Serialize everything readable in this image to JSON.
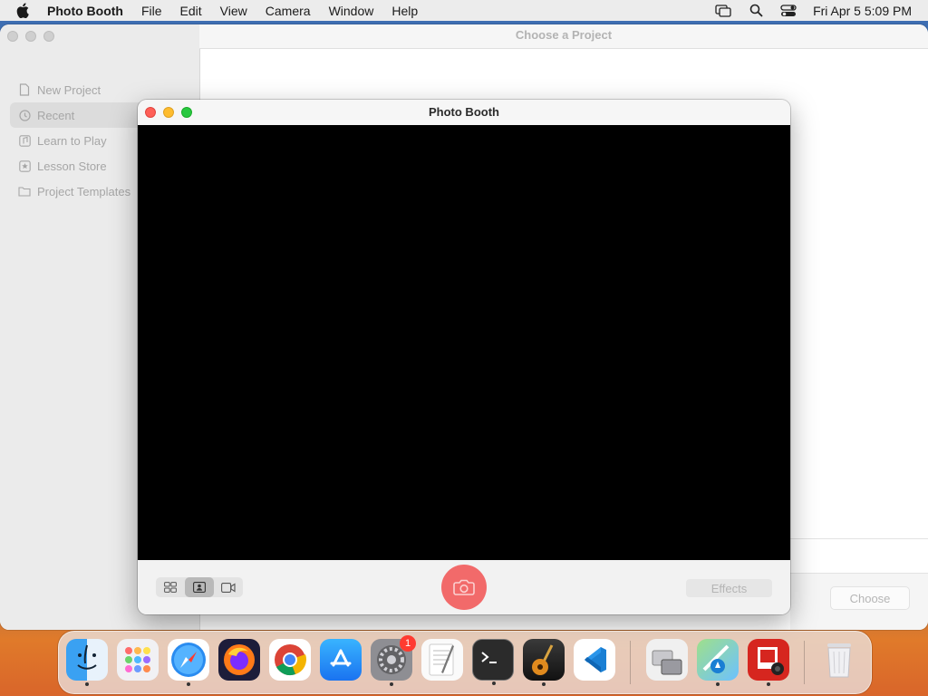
{
  "menubar": {
    "app_name": "Photo Booth",
    "menus": [
      "File",
      "Edit",
      "View",
      "Camera",
      "Window",
      "Help"
    ],
    "datetime": "Fri Apr 5  5:09 PM"
  },
  "garageband": {
    "title": "Choose a Project",
    "sidebar": [
      {
        "label": "New Project",
        "icon": "document-icon"
      },
      {
        "label": "Recent",
        "icon": "clock-icon",
        "selected": true
      },
      {
        "label": "Learn to Play",
        "icon": "music-note-icon"
      },
      {
        "label": "Lesson Store",
        "icon": "star-icon"
      },
      {
        "label": "Project Templates",
        "icon": "folder-icon"
      }
    ],
    "choose_label": "Choose"
  },
  "photobooth": {
    "title": "Photo Booth",
    "effects_label": "Effects",
    "view_mode": "single-photo"
  },
  "dock": {
    "apps": [
      {
        "name": "Finder",
        "icon": "finder-icon"
      },
      {
        "name": "Launchpad",
        "icon": "launchpad-icon"
      },
      {
        "name": "Safari",
        "icon": "safari-icon"
      },
      {
        "name": "Firefox",
        "icon": "firefox-icon"
      },
      {
        "name": "Chrome",
        "icon": "chrome-icon"
      },
      {
        "name": "App Store",
        "icon": "app-store-icon"
      },
      {
        "name": "System Settings",
        "icon": "system-settings-icon",
        "badge": "1"
      },
      {
        "name": "TextEdit",
        "icon": "textedit-icon"
      },
      {
        "name": "Terminal",
        "icon": "terminal-icon"
      },
      {
        "name": "GarageBand",
        "icon": "garageband-icon"
      },
      {
        "name": "Visual Studio Code",
        "icon": "vscode-icon"
      },
      {
        "name": "Migration Assistant",
        "icon": "migration-assistant-icon"
      },
      {
        "name": "Maps",
        "icon": "maps-icon"
      },
      {
        "name": "Photo Booth",
        "icon": "photo-booth-icon"
      },
      {
        "name": "Trash",
        "icon": "trash-icon"
      }
    ]
  }
}
